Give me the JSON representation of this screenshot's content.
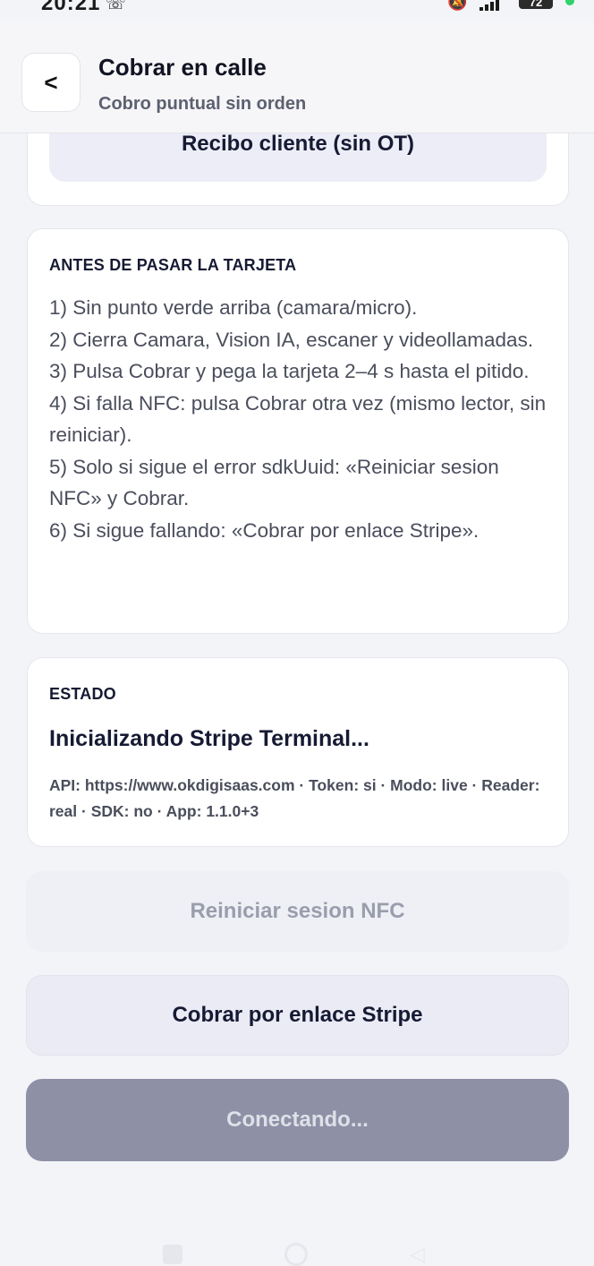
{
  "status_bar": {
    "time": "20:21",
    "overflow": "···",
    "battery": "72"
  },
  "header": {
    "back_label": "<",
    "title": "Cobrar en calle",
    "subtitle": "Cobro puntual sin orden"
  },
  "receipt_button": {
    "label": "Recibo cliente (sin OT)"
  },
  "instructions": {
    "title": "ANTES DE PASAR LA TARJETA",
    "steps": [
      "1) Sin punto verde arriba (camara/micro).",
      "2) Cierra Camara, Vision IA, escaner y videollamadas.",
      "3) Pulsa Cobrar y pega la tarjeta 2–4 s hasta el pitido.",
      "4) Si falla NFC: pulsa Cobrar otra vez (mismo lector, sin reiniciar).",
      "5) Solo si sigue el error sdkUuid: «Reiniciar sesion NFC» y Cobrar.",
      "6) Si sigue fallando: «Cobrar por enlace Stripe»."
    ]
  },
  "state": {
    "title": "ESTADO",
    "message": "Inicializando Stripe Terminal...",
    "info": "API: https://www.okdigisaas.com · Token: si · Modo: live · Reader: real · SDK: no · App: 1.1.0+3"
  },
  "buttons": {
    "reset_nfc": "Reiniciar sesion NFC",
    "stripe_link": "Cobrar por enlace Stripe",
    "connecting": "Conectando..."
  },
  "colors": {
    "primary_disabled": "#8e90a6",
    "status_green": "#2fd36a"
  }
}
